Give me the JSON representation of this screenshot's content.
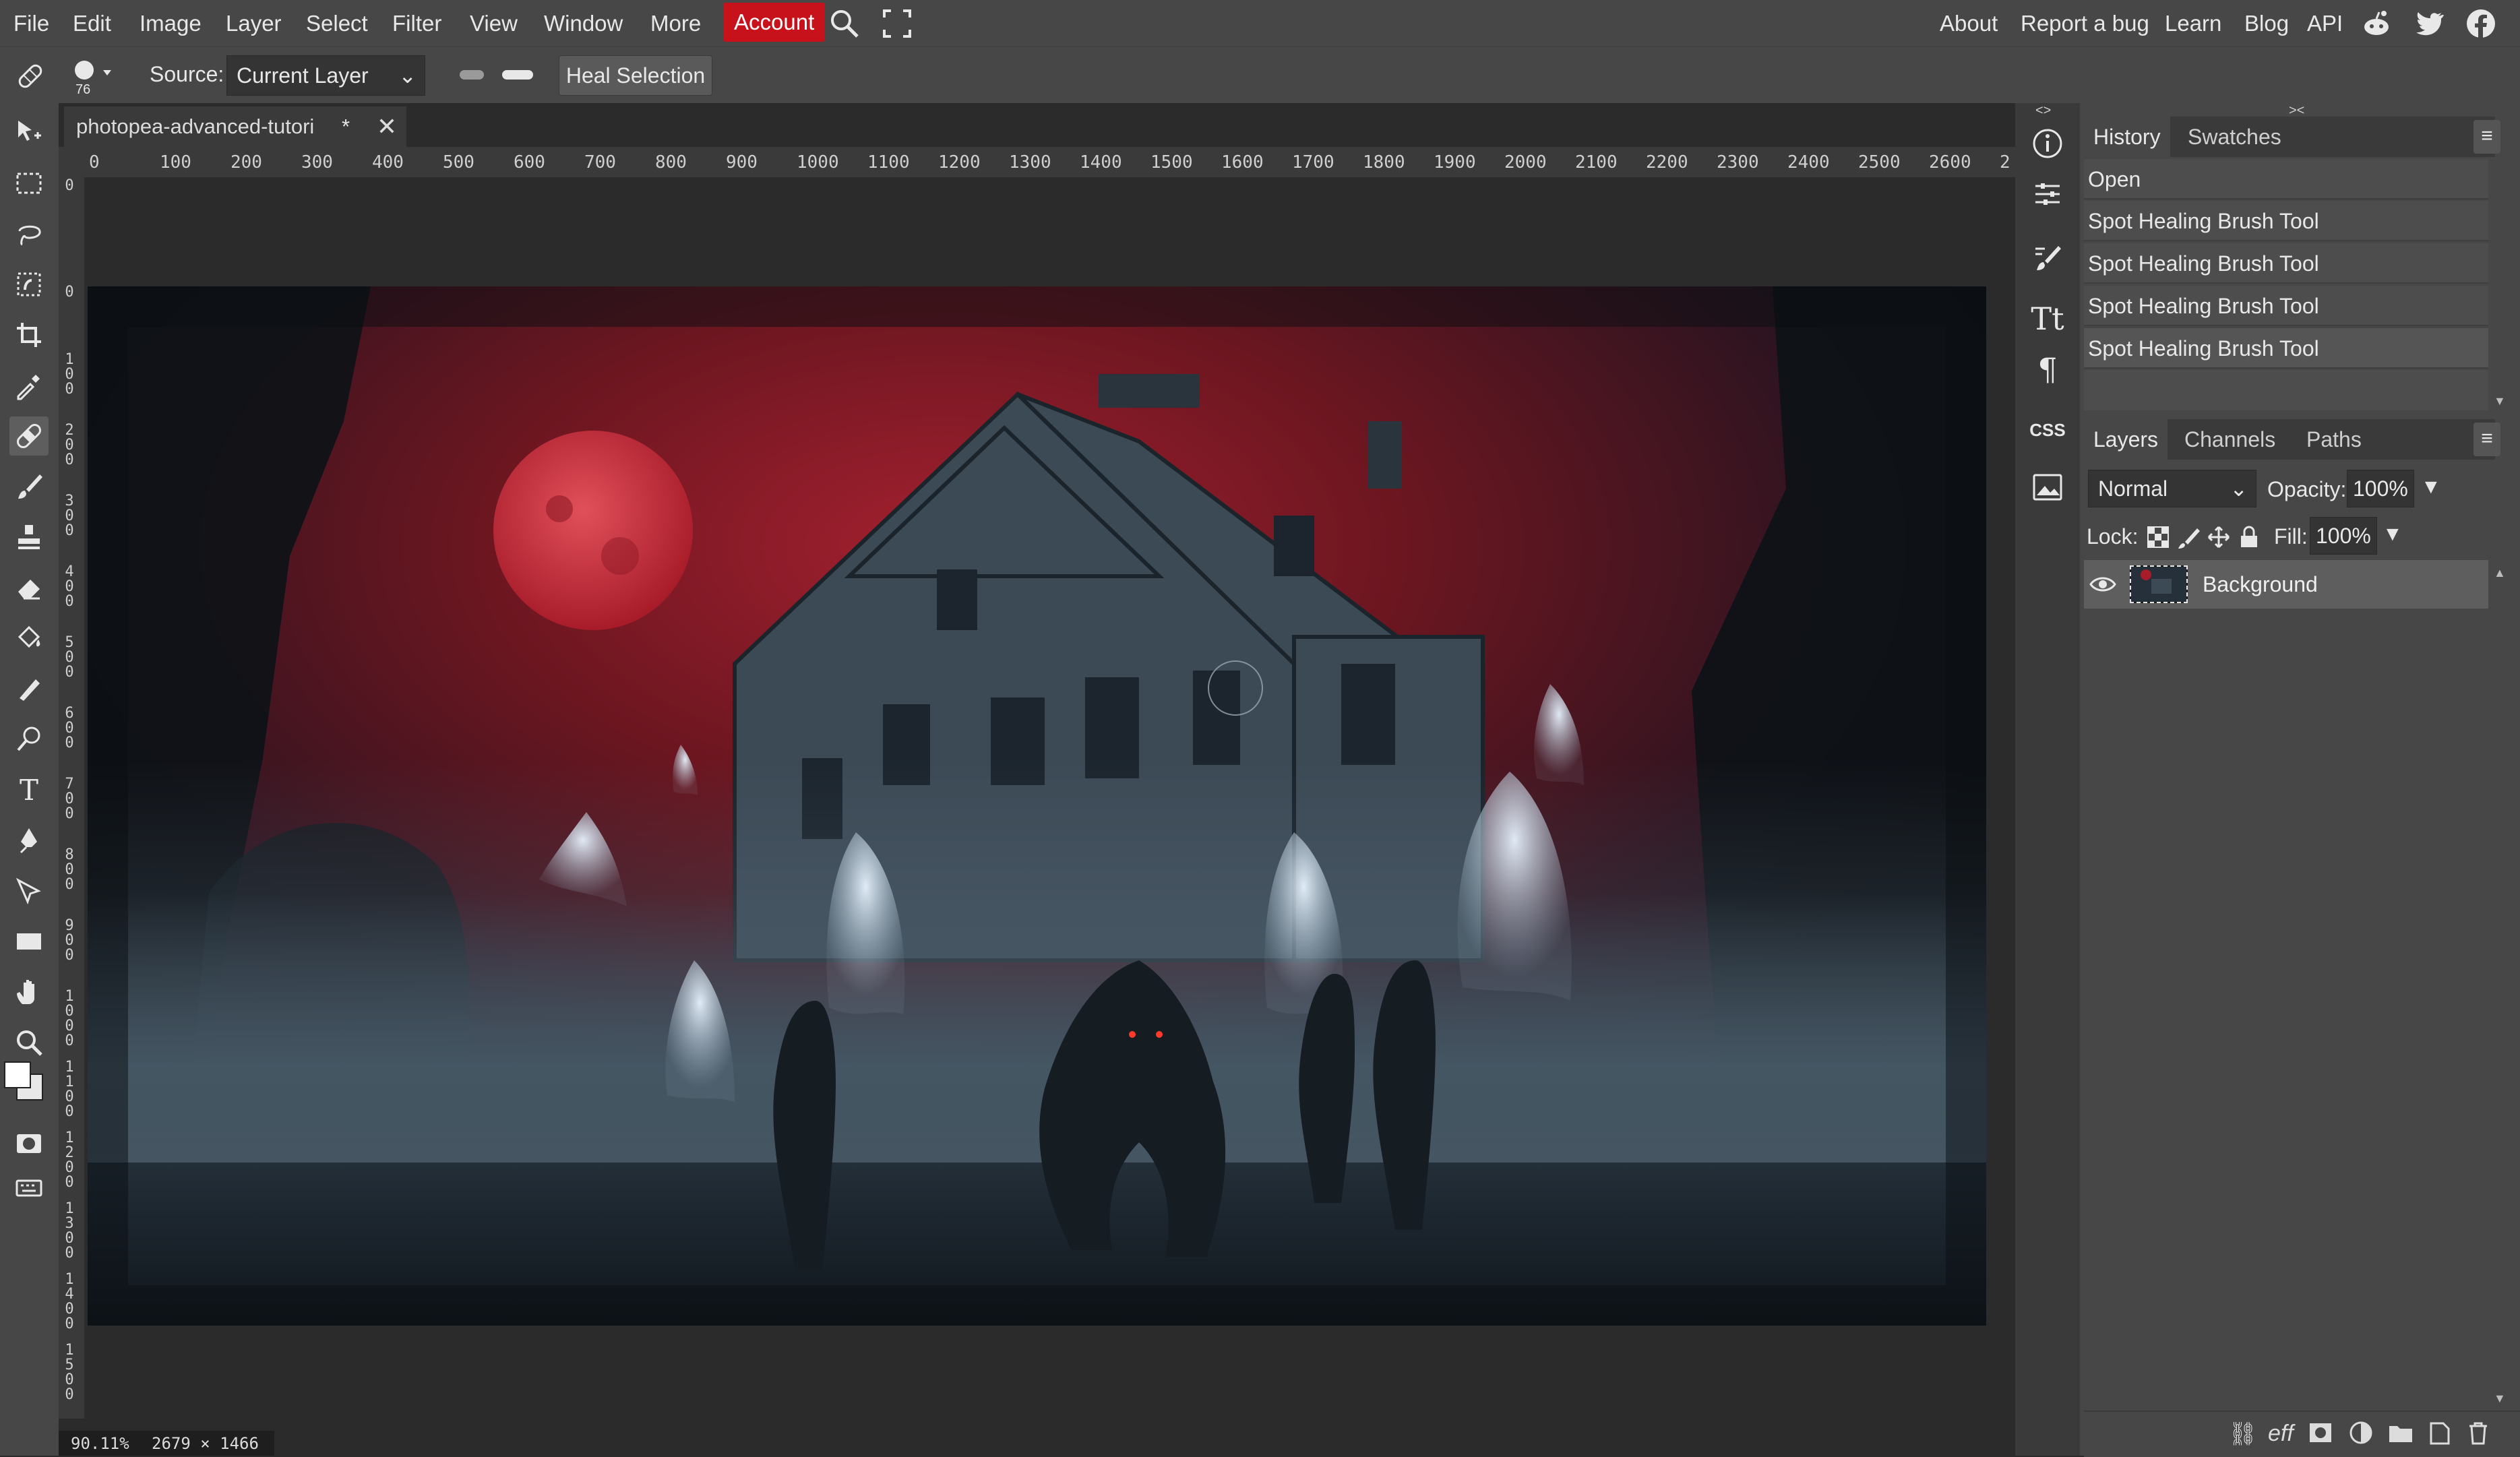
{
  "menubar": {
    "items": [
      "File",
      "Edit",
      "Image",
      "Layer",
      "Select",
      "Filter",
      "View",
      "Window",
      "More"
    ],
    "account_label": "Account",
    "right_links": [
      "About",
      "Report a bug",
      "Learn",
      "Blog",
      "API"
    ],
    "icons": [
      "search-icon",
      "fullscreen-icon",
      "reddit-icon",
      "twitter-icon",
      "facebook-icon"
    ]
  },
  "options": {
    "brush_size": "76",
    "source_label": "Source:",
    "source_value": "Current Layer",
    "heal_selection_label": "Heal Selection"
  },
  "document": {
    "tab_title": "photopea-advanced-tutori",
    "tab_modified": "*",
    "tab_close": "✕",
    "ruler_top": [
      "0",
      "100",
      "200",
      "300",
      "400",
      "500",
      "600",
      "700",
      "800",
      "900",
      "1000",
      "1100",
      "1200",
      "1300",
      "1400",
      "1500",
      "1600",
      "1700",
      "1800",
      "1900",
      "2000",
      "2100",
      "2200",
      "2300",
      "2400",
      "2500",
      "2600",
      "2"
    ],
    "ruler_left": [
      "0",
      "0",
      "100",
      "200",
      "300",
      "400",
      "500",
      "600",
      "700",
      "800",
      "900",
      "1000",
      "1100",
      "1200",
      "1300",
      "1400",
      "1500"
    ],
    "zoom": "90.11%",
    "dimensions": "2679 × 1466"
  },
  "history": {
    "tabs": [
      "History",
      "Swatches"
    ],
    "items": [
      "Open",
      "Spot Healing Brush Tool",
      "Spot Healing Brush Tool",
      "Spot Healing Brush Tool",
      "Spot Healing Brush Tool"
    ]
  },
  "layers": {
    "tabs": [
      "Layers",
      "Channels",
      "Paths"
    ],
    "blend_mode": "Normal",
    "opacity_label": "Opacity:",
    "opacity_value": "100%",
    "lock_label": "Lock:",
    "fill_label": "Fill:",
    "fill_value": "100%",
    "items": [
      {
        "name": "Background",
        "visible": true
      }
    ],
    "footer_label": "eff"
  },
  "mini_panel": {
    "css_label": "CSS",
    "toggle_left": "<>",
    "toggle_right": "><"
  },
  "colors": {
    "accent_red": "#c8121b",
    "panel_bg": "#474747",
    "canvas_bg": "#2b2b2b"
  }
}
